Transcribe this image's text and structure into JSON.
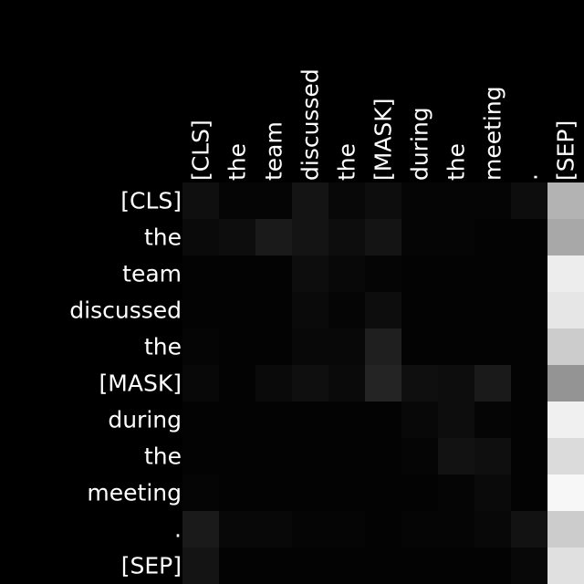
{
  "chart_data": {
    "type": "heatmap",
    "title": "",
    "xlabel": "",
    "ylabel": "",
    "x_tokens": [
      "[CLS]",
      "the",
      "team",
      "discussed",
      "the",
      "[MASK]",
      "during",
      "the",
      "meeting",
      ".",
      "[SEP]"
    ],
    "y_tokens": [
      "[CLS]",
      "the",
      "team",
      "discussed",
      "the",
      "[MASK]",
      "during",
      "the",
      "meeting",
      ".",
      "[SEP]"
    ],
    "value_range": [
      0,
      1
    ],
    "colormap": "grayscale",
    "legend": "none",
    "grid": false,
    "values": [
      [
        0.06,
        0.02,
        0.02,
        0.08,
        0.03,
        0.05,
        0.02,
        0.02,
        0.02,
        0.05,
        0.7
      ],
      [
        0.04,
        0.05,
        0.1,
        0.08,
        0.05,
        0.08,
        0.02,
        0.02,
        0.01,
        0.01,
        0.66
      ],
      [
        0.01,
        0.01,
        0.01,
        0.05,
        0.03,
        0.02,
        0.01,
        0.01,
        0.01,
        0.01,
        0.93
      ],
      [
        0.01,
        0.01,
        0.01,
        0.04,
        0.02,
        0.05,
        0.01,
        0.01,
        0.01,
        0.01,
        0.9
      ],
      [
        0.02,
        0.01,
        0.01,
        0.03,
        0.03,
        0.12,
        0.01,
        0.01,
        0.01,
        0.01,
        0.8
      ],
      [
        0.03,
        0.01,
        0.04,
        0.06,
        0.04,
        0.14,
        0.06,
        0.05,
        0.1,
        0.01,
        0.58
      ],
      [
        0.01,
        0.01,
        0.01,
        0.01,
        0.01,
        0.01,
        0.03,
        0.05,
        0.02,
        0.01,
        0.94
      ],
      [
        0.01,
        0.01,
        0.01,
        0.01,
        0.01,
        0.01,
        0.02,
        0.07,
        0.06,
        0.01,
        0.86
      ],
      [
        0.02,
        0.01,
        0.01,
        0.01,
        0.01,
        0.01,
        0.01,
        0.02,
        0.04,
        0.01,
        0.97
      ],
      [
        0.1,
        0.03,
        0.03,
        0.02,
        0.02,
        0.01,
        0.02,
        0.02,
        0.03,
        0.07,
        0.8
      ],
      [
        0.08,
        0.01,
        0.01,
        0.01,
        0.01,
        0.01,
        0.01,
        0.01,
        0.01,
        0.03,
        0.88
      ]
    ]
  }
}
